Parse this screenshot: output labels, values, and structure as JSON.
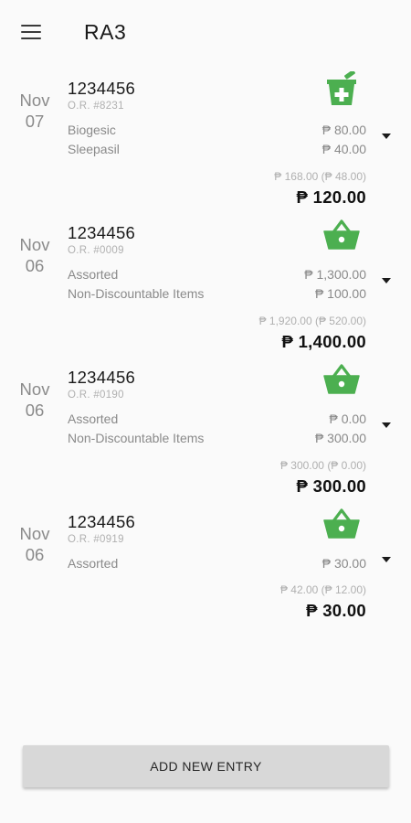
{
  "app": {
    "title": "RA3"
  },
  "colors": {
    "accent": "#4caf50",
    "background": "#fafafa",
    "button": "#d8d8d8"
  },
  "entries": [
    {
      "date": {
        "month": "Nov",
        "day": "07"
      },
      "or_main": "1234456",
      "or_number": "O.R. #8231",
      "category_icon": "pharmacy-icon",
      "items": [
        {
          "name": "Biogesic",
          "price": "₱ 80.00"
        },
        {
          "name": "Sleepasil",
          "price": "₱ 40.00"
        }
      ],
      "subtotal": "₱ 168.00 (₱ 48.00)",
      "total": "₱ 120.00"
    },
    {
      "date": {
        "month": "Nov",
        "day": "06"
      },
      "or_main": "1234456",
      "or_number": "O.R. #0009",
      "category_icon": "grocery-basket-icon",
      "items": [
        {
          "name": "Assorted",
          "price": "₱ 1,300.00"
        },
        {
          "name": "Non-Discountable Items",
          "price": "₱ 100.00"
        }
      ],
      "subtotal": "₱ 1,920.00 (₱ 520.00)",
      "total": "₱ 1,400.00"
    },
    {
      "date": {
        "month": "Nov",
        "day": "06"
      },
      "or_main": "1234456",
      "or_number": "O.R. #0190",
      "category_icon": "grocery-basket-icon",
      "items": [
        {
          "name": "Assorted",
          "price": "₱ 0.00"
        },
        {
          "name": "Non-Discountable Items",
          "price": "₱ 300.00"
        }
      ],
      "subtotal": "₱ 300.00 (₱ 0.00)",
      "total": "₱ 300.00"
    },
    {
      "date": {
        "month": "Nov",
        "day": "06"
      },
      "or_main": "1234456",
      "or_number": "O.R. #0919",
      "category_icon": "grocery-basket-icon",
      "items": [
        {
          "name": "Assorted",
          "price": "₱ 30.00"
        }
      ],
      "subtotal": "₱ 42.00 (₱ 12.00)",
      "total": "₱ 30.00"
    }
  ],
  "actions": {
    "add_entry_label": "ADD NEW ENTRY"
  }
}
